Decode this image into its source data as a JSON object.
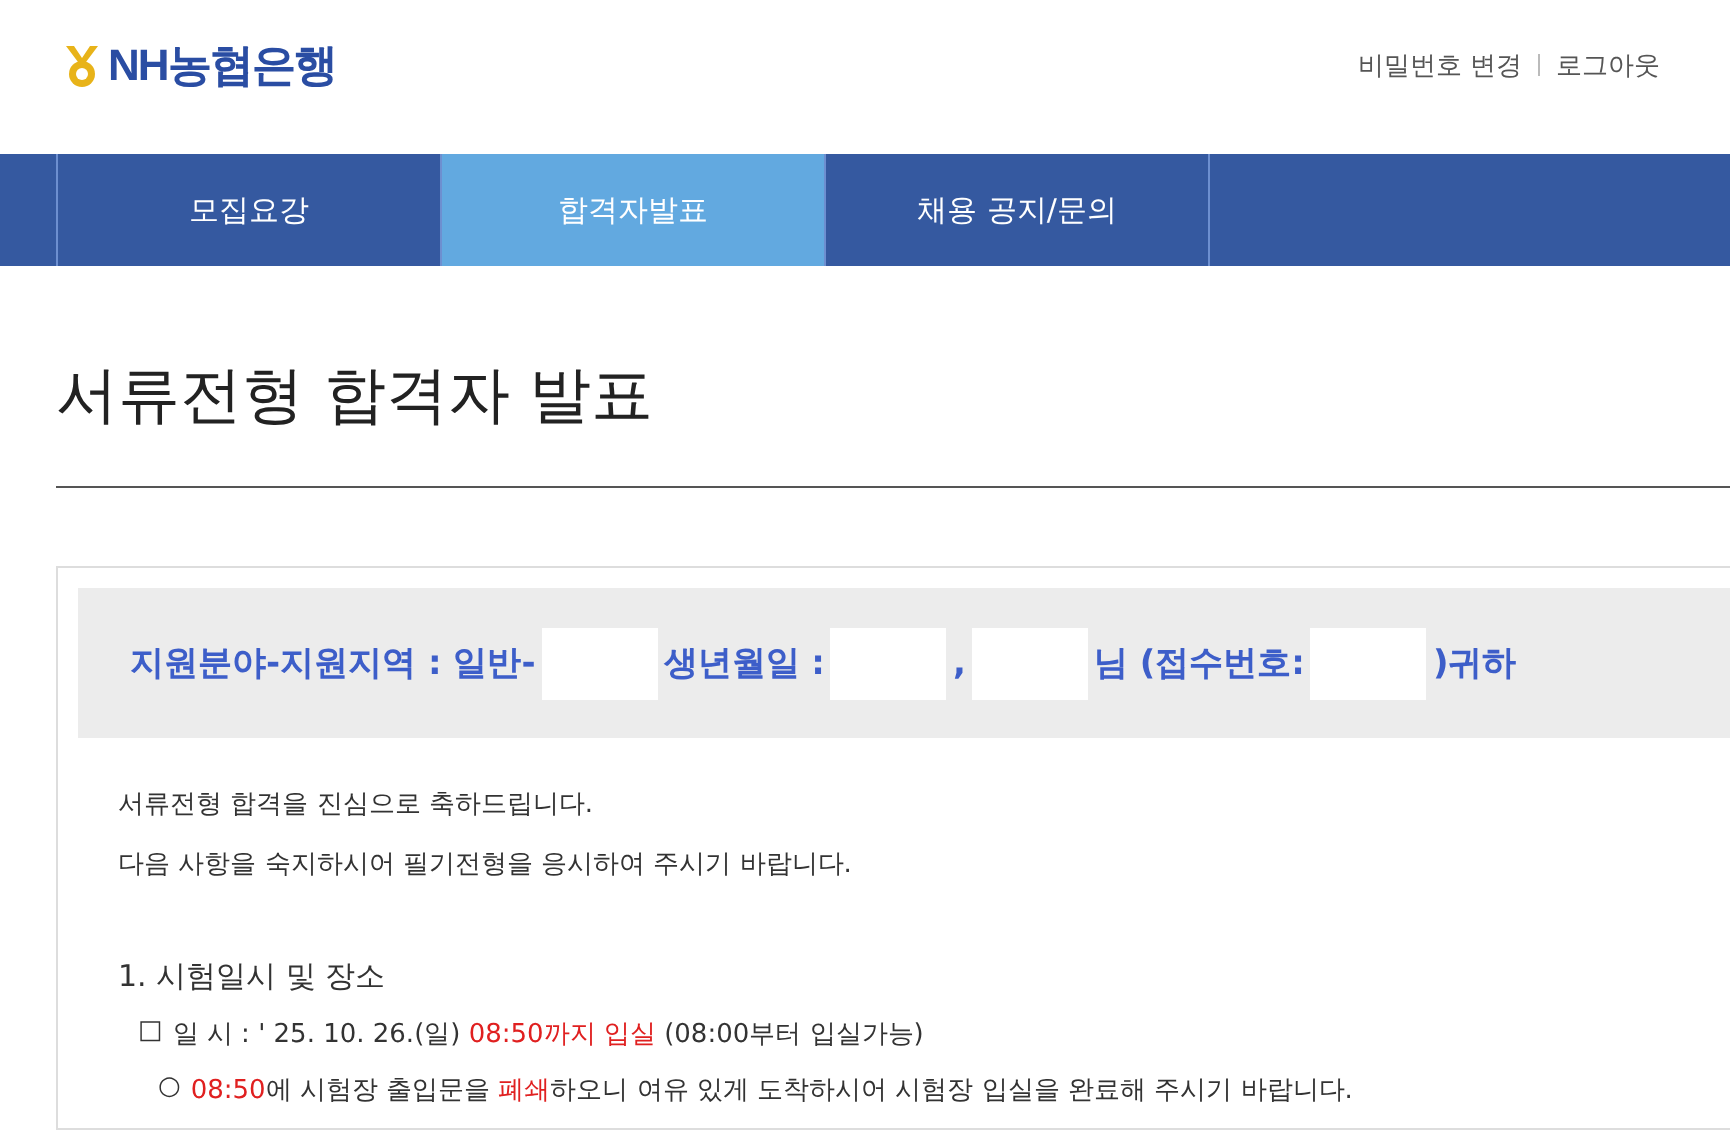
{
  "header": {
    "logo": "NH농협은행",
    "links": [
      "비밀번호 변경",
      "로그아웃"
    ]
  },
  "tabs": [
    {
      "label": "모집요강",
      "selected": false
    },
    {
      "label": "합격자발표",
      "selected": true
    },
    {
      "label": "채용 공지/문의",
      "selected": false
    }
  ],
  "title": "서류전형 합격자 발표",
  "greeting": [
    {
      "kind": "text",
      "text": "지원분야-지원지역 : 일반-"
    },
    {
      "kind": "redacted"
    },
    {
      "kind": "text",
      "text": "생년월일 :"
    },
    {
      "kind": "redacted"
    },
    {
      "kind": "text",
      "text": ","
    },
    {
      "kind": "redacted"
    },
    {
      "kind": "text",
      "text": "님 (접수번호:"
    },
    {
      "kind": "redacted"
    },
    {
      "kind": "text",
      "text": ")귀하"
    }
  ],
  "intro": [
    "서류전형 합격을 진심으로 축하드립니다.",
    "다음 사항을 숙지하시어 필기전형을 응시하여 주시기 바랍니다."
  ],
  "section": "1. 시험일시 및 장소",
  "items": [
    {
      "bullet": "□",
      "segments": [
        {
          "text": "일 시 :  ' 25. 10. 26.(일) ",
          "red": false
        },
        {
          "text": "08:50까지 입실",
          "red": true
        },
        {
          "text": " (08:00부터 입실가능)",
          "red": false
        }
      ]
    },
    {
      "bullet": "○",
      "segments": [
        {
          "text": "08:50",
          "red": true
        },
        {
          "text": "에 시험장 출입문을 ",
          "red": false
        },
        {
          "text": "폐쇄",
          "red": true
        },
        {
          "text": "하오니 여유 있게 도착하시어 시험장 입실을 완료해 주시기 바랍니다.",
          "red": false
        }
      ]
    }
  ]
}
